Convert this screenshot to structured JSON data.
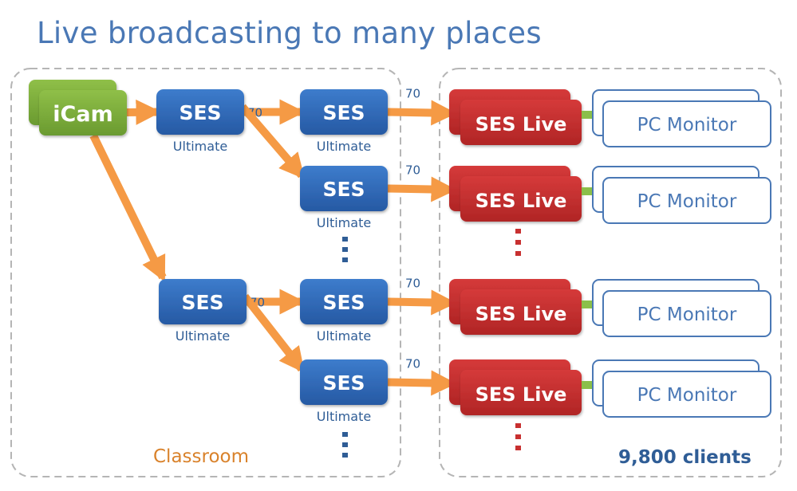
{
  "title": "Live broadcasting to many places",
  "colors": {
    "title": "#4a78b5",
    "camera": "#7aab3a",
    "server": "#2f6cb8",
    "live": "#c83030",
    "monitor_border": "#4a78b5",
    "arrow": "#f59a45",
    "link": "#8bbf4a",
    "classroom_label": "#d9822b",
    "clients_label": "#2f5d96",
    "region_border": "#b5b5b5"
  },
  "regions": {
    "classroom": {
      "label": "Classroom"
    },
    "clients": {
      "label": "9,800 clients"
    }
  },
  "source": {
    "label": "iCam"
  },
  "servers": [
    {
      "id": "s1",
      "label": "SES",
      "sublabel": "Ultimate"
    },
    {
      "id": "s2",
      "label": "SES",
      "sublabel": "Ultimate"
    },
    {
      "id": "s3",
      "label": "SES",
      "sublabel": "Ultimate"
    },
    {
      "id": "s4",
      "label": "SES",
      "sublabel": "Ultimate"
    },
    {
      "id": "s5",
      "label": "SES",
      "sublabel": "Ultimate"
    },
    {
      "id": "s6",
      "label": "SES",
      "sublabel": "Ultimate"
    }
  ],
  "live_nodes": [
    {
      "label": "SES Live",
      "monitor": "PC Monitor"
    },
    {
      "label": "SES Live",
      "monitor": "PC Monitor"
    },
    {
      "label": "SES Live",
      "monitor": "PC Monitor"
    },
    {
      "label": "SES Live",
      "monitor": "PC Monitor"
    }
  ],
  "edges": [
    {
      "from": "iCam",
      "to": "s1",
      "label": ""
    },
    {
      "from": "iCam",
      "to": "s4",
      "label": ""
    },
    {
      "from": "s1",
      "to": "s2",
      "label": "70"
    },
    {
      "from": "s1",
      "to": "s3",
      "label": ""
    },
    {
      "from": "s4",
      "to": "s5",
      "label": "70"
    },
    {
      "from": "s4",
      "to": "s6",
      "label": ""
    },
    {
      "from": "s2",
      "to": "live1",
      "label": "70"
    },
    {
      "from": "s3",
      "to": "live2",
      "label": "70"
    },
    {
      "from": "s5",
      "to": "live3",
      "label": "70"
    },
    {
      "from": "s6",
      "to": "live4",
      "label": "70"
    }
  ]
}
